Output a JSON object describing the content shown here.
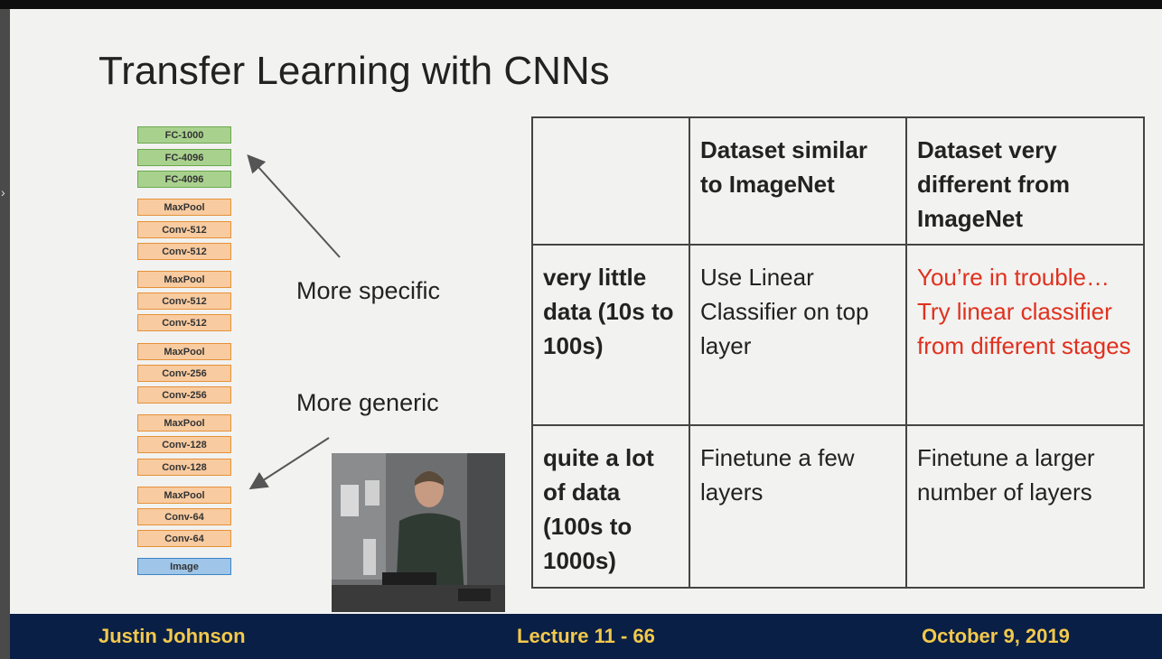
{
  "slide": {
    "title": "Transfer Learning with CNNs",
    "layers": [
      {
        "label": "FC-1000",
        "kind": "fc"
      },
      {
        "label": "FC-4096",
        "kind": "fc"
      },
      {
        "label": "FC-4096",
        "kind": "fc"
      },
      {
        "label": "MaxPool",
        "kind": "conv"
      },
      {
        "label": "Conv-512",
        "kind": "conv"
      },
      {
        "label": "Conv-512",
        "kind": "conv"
      },
      {
        "label": "MaxPool",
        "kind": "conv"
      },
      {
        "label": "Conv-512",
        "kind": "conv"
      },
      {
        "label": "Conv-512",
        "kind": "conv"
      },
      {
        "label": "MaxPool",
        "kind": "conv"
      },
      {
        "label": "Conv-256",
        "kind": "conv"
      },
      {
        "label": "Conv-256",
        "kind": "conv"
      },
      {
        "label": "MaxPool",
        "kind": "conv"
      },
      {
        "label": "Conv-128",
        "kind": "conv"
      },
      {
        "label": "Conv-128",
        "kind": "conv"
      },
      {
        "label": "MaxPool",
        "kind": "conv"
      },
      {
        "label": "Conv-64",
        "kind": "conv"
      },
      {
        "label": "Conv-64",
        "kind": "conv"
      },
      {
        "label": "Image",
        "kind": "img"
      }
    ],
    "more_specific": "More specific",
    "more_generic": "More generic",
    "table": {
      "header": [
        "",
        "Dataset similar to ImageNet",
        "Dataset very different from ImageNet"
      ],
      "rows": [
        {
          "label": "very little data (10s to 100s)",
          "similar": "Use Linear Classifier on top layer",
          "different": "You’re in trouble… Try linear classifier from different stages"
        },
        {
          "label": "quite a lot of data (100s to 1000s)",
          "similar": "Finetune a few layers",
          "different": "Finetune a larger number of layers"
        }
      ]
    }
  },
  "footer": {
    "author": "Justin Johnson",
    "lecture": "Lecture 11 - 66",
    "date": "October 9, 2019"
  },
  "colors": {
    "fc": "#a9d18e",
    "conv": "#f8cba0",
    "image": "#9fc5e8",
    "footer_bg": "#0a1f45",
    "footer_text": "#f2c94c",
    "warning_text": "#e0301e"
  },
  "icons": {
    "left_nav": "chevron-right-icon"
  }
}
